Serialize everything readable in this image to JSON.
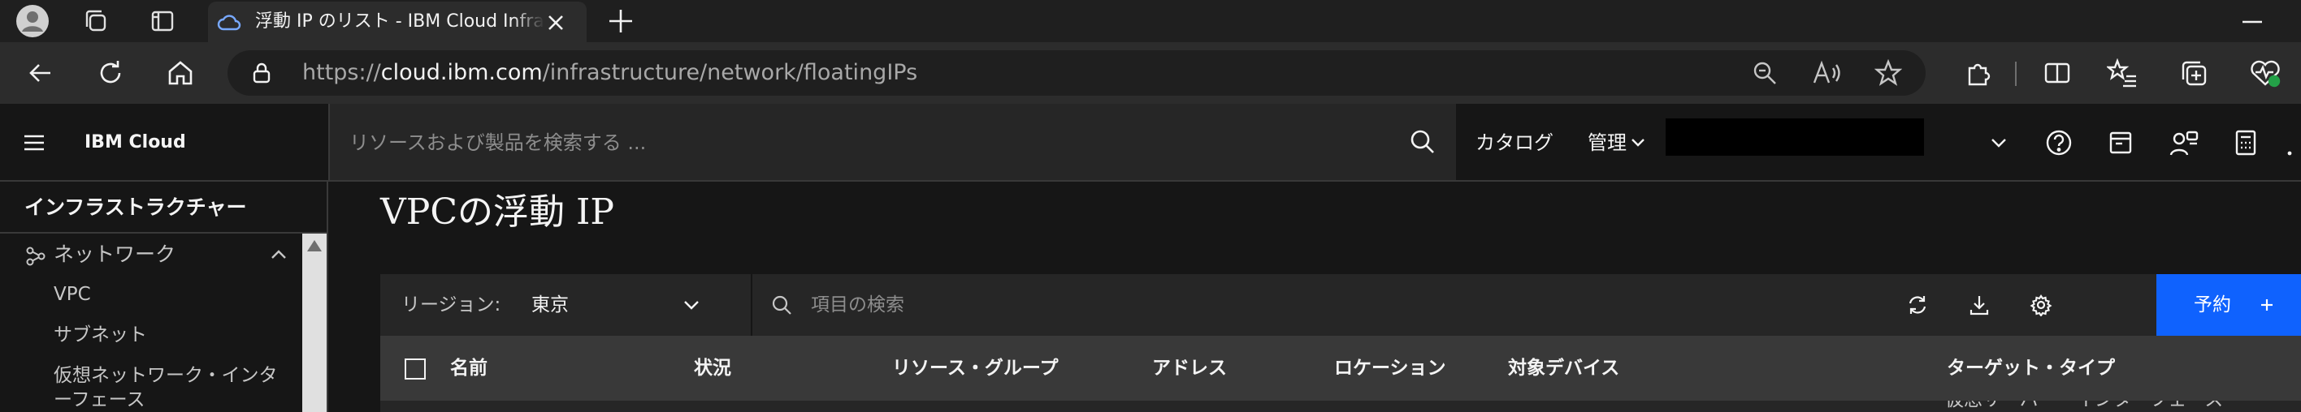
{
  "browser": {
    "tab_title": "浮動 IP のリスト - IBM Cloud Infrastructure",
    "url_prefix": "https://",
    "url_host": "cloud.ibm.com",
    "url_path": "/infrastructure/network/floatingIPs"
  },
  "header": {
    "brand": "IBM Cloud",
    "search_placeholder": "リソースおよび製品を検索する ...",
    "catalog": "カタログ",
    "manage": "管理"
  },
  "sidebar": {
    "title": "インフラストラクチャー",
    "network": "ネットワーク",
    "items": [
      {
        "label": "VPC"
      },
      {
        "label": "サブネット"
      },
      {
        "label": "仮想ネットワーク・インターフェース"
      }
    ]
  },
  "main": {
    "title": "VPCの浮動 IP",
    "region_label": "リージョン:",
    "region_value": "東京",
    "search_placeholder": "項目の検索",
    "reserve_label": "予約",
    "columns": [
      "名前",
      "状況",
      "リソース・グループ",
      "アドレス",
      "ロケーション",
      "対象デバイス",
      "ターゲット・タイプ"
    ],
    "partial_row_text": "仮想サーバー・インターフェース"
  },
  "colors": {
    "accent": "#0f62fe",
    "background": "#161616",
    "toolbar": "#262626",
    "table_header": "#393939"
  }
}
